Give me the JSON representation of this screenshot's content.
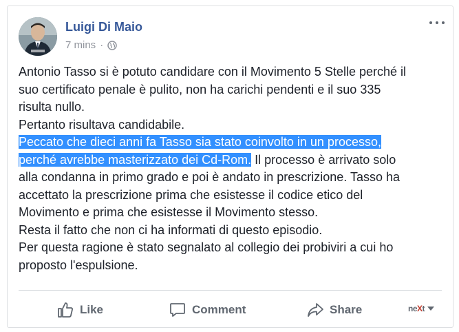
{
  "post": {
    "author": "Luigi Di Maio",
    "time": "7 mins",
    "separator": "·",
    "lines": [
      {
        "text": "Antonio Tasso si è potuto candidare con il Movimento 5 Stelle perché il"
      },
      {
        "text": "suo certificato penale è pulito, non ha carichi pendenti e il suo 335"
      },
      {
        "text": "risulta nullo."
      },
      {
        "text": "Pertanto risultava candidabile."
      },
      {
        "highlight": "Peccato che dieci anni fa Tasso sia stato coinvolto in un processo,"
      },
      {
        "highlight": "perché avrebbe masterizzato dei Cd-Rom.",
        "text": " Il processo è arrivato solo"
      },
      {
        "text": "alla condanna in primo grado e poi è andato in prescrizione. Tasso ha"
      },
      {
        "text": "accettato la prescrizione prima che esistesse il codice etico del"
      },
      {
        "text": "Movimento e prima che esistesse il Movimento stesso."
      },
      {
        "text": "Resta il fatto che non ci ha informati di questo episodio."
      },
      {
        "text": "Per questa ragione è stato segnalato al collegio dei probiviri a cui ho"
      },
      {
        "text": "proposto l'espulsione."
      }
    ]
  },
  "actions": {
    "like": "Like",
    "comment": "Comment",
    "share": "Share",
    "next_prefix": "ne",
    "next_x": "X",
    "next_suffix": "t"
  },
  "colors": {
    "author_link": "#365899",
    "highlight": "#3390ff",
    "muted": "#90949c"
  },
  "icons": [
    "globe-icon",
    "more-options-icon",
    "like-icon",
    "comment-icon",
    "share-icon",
    "dropdown-caret-icon"
  ]
}
